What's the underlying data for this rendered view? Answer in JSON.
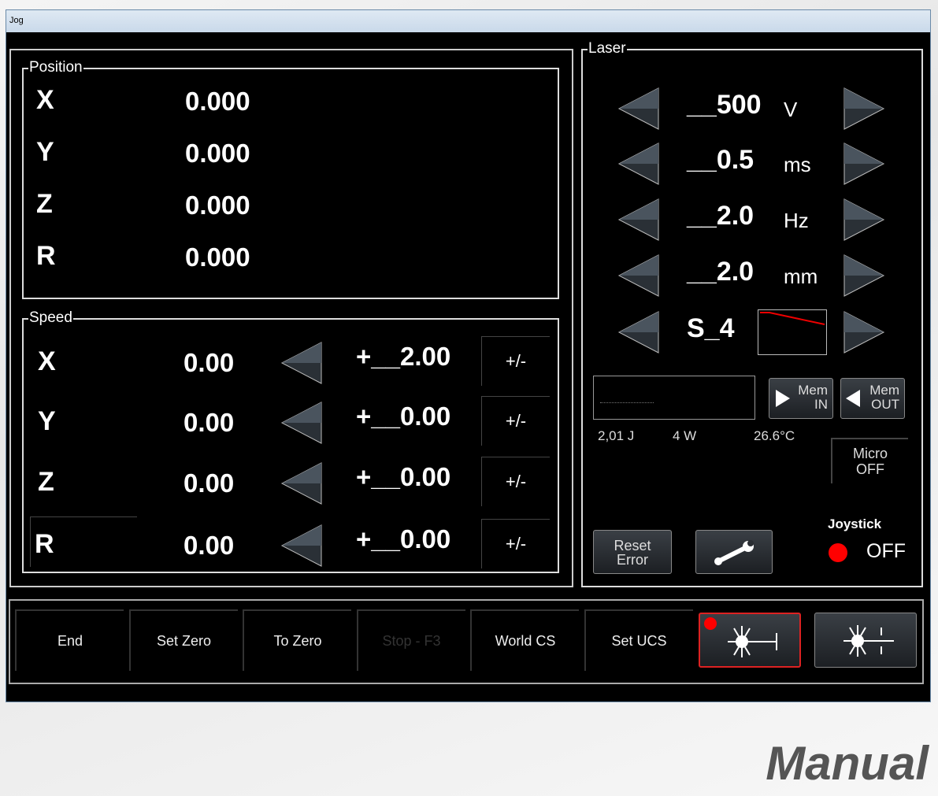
{
  "window": {
    "title": "Jog"
  },
  "position": {
    "label": "Position",
    "rows": [
      {
        "axis": "X",
        "value": "0.000"
      },
      {
        "axis": "Y",
        "value": "0.000"
      },
      {
        "axis": "Z",
        "value": "0.000"
      },
      {
        "axis": "R",
        "value": "0.000"
      }
    ]
  },
  "speed": {
    "label": "Speed",
    "toggle_label": "+/-",
    "rows": [
      {
        "axis": "X",
        "value": "0.00",
        "step": "+__2.00"
      },
      {
        "axis": "Y",
        "value": "0.00",
        "step": "+__0.00"
      },
      {
        "axis": "Z",
        "value": "0.00",
        "step": "+__0.00"
      },
      {
        "axis": "R",
        "value": "0.00",
        "step": "+__0.00"
      }
    ]
  },
  "laser": {
    "label": "Laser",
    "params": [
      {
        "value": "__500",
        "unit": "V"
      },
      {
        "value": "__0.5",
        "unit": "ms"
      },
      {
        "value": "__2.0",
        "unit": "Hz"
      },
      {
        "value": "__2.0",
        "unit": "mm"
      },
      {
        "value": "S_4",
        "unit": ""
      }
    ],
    "mem_in": [
      "Mem",
      "IN"
    ],
    "mem_out": [
      "Mem",
      "OUT"
    ],
    "energy": "2,01 J",
    "power": "4 W",
    "temperature": "26.6°C",
    "micro": [
      "Micro",
      "OFF"
    ],
    "reset": [
      "Reset",
      "Error"
    ],
    "joystick_label": "Joystick",
    "joystick_state": "OFF",
    "joystick_color": "#ff0000"
  },
  "toolbar": {
    "buttons": [
      {
        "label": "End",
        "enabled": true
      },
      {
        "label": "Set Zero",
        "enabled": true
      },
      {
        "label": "To Zero",
        "enabled": true
      },
      {
        "label": "Stop - F3",
        "enabled": false
      },
      {
        "label": "World CS",
        "enabled": true
      },
      {
        "label": "Set UCS",
        "enabled": true
      }
    ]
  },
  "watermark": "Manual"
}
